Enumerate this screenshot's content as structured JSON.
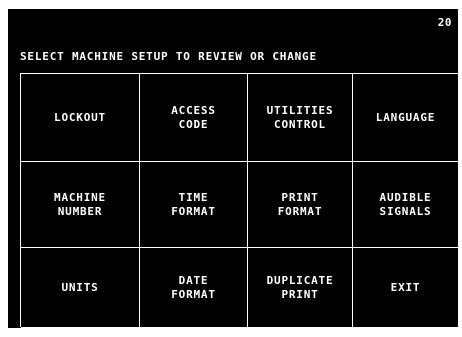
{
  "header": {
    "screen_number": "20",
    "prompt": "SELECT MACHINE SETUP TO REVIEW OR CHANGE"
  },
  "menu": {
    "items": [
      {
        "label": "LOCKOUT"
      },
      {
        "label": "ACCESS\nCODE"
      },
      {
        "label": "UTILITIES\nCONTROL"
      },
      {
        "label": "LANGUAGE"
      },
      {
        "label": "MACHINE\nNUMBER"
      },
      {
        "label": "TIME\nFORMAT"
      },
      {
        "label": "PRINT\nFORMAT"
      },
      {
        "label": "AUDIBLE\nSIGNALS"
      },
      {
        "label": "UNITS"
      },
      {
        "label": "DATE\nFORMAT"
      },
      {
        "label": "DUPLICATE\nPRINT"
      },
      {
        "label": "EXIT"
      }
    ]
  }
}
